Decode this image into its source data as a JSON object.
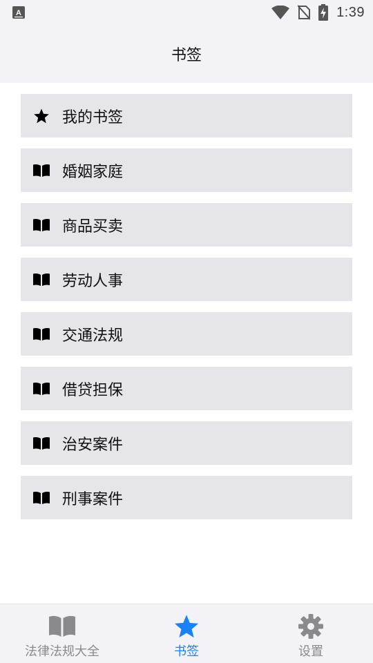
{
  "status_bar": {
    "time": "1:39",
    "left_icon": "keyboard-a-icon",
    "icons": [
      "wifi-icon",
      "no-sim-icon",
      "battery-charging-icon"
    ]
  },
  "header": {
    "title": "书签"
  },
  "list": {
    "items": [
      {
        "label": "我的书签",
        "icon": "star-icon"
      },
      {
        "label": "婚姻家庭",
        "icon": "book-icon"
      },
      {
        "label": "商品买卖",
        "icon": "book-icon"
      },
      {
        "label": "劳动人事",
        "icon": "book-icon"
      },
      {
        "label": "交通法规",
        "icon": "book-icon"
      },
      {
        "label": "借贷担保",
        "icon": "book-icon"
      },
      {
        "label": "治安案件",
        "icon": "book-icon"
      },
      {
        "label": "刑事案件",
        "icon": "book-icon"
      }
    ]
  },
  "tabbar": {
    "tabs": [
      {
        "label": "法律法规大全",
        "icon": "book-icon",
        "active": false
      },
      {
        "label": "书签",
        "icon": "star-icon",
        "active": true
      },
      {
        "label": "设置",
        "icon": "gear-icon",
        "active": false
      }
    ]
  },
  "colors": {
    "active": "#1a82f7",
    "inactive": "#8a8a8e",
    "item_bg": "#e5e5ea",
    "bar_bg": "#f2f2f7"
  }
}
